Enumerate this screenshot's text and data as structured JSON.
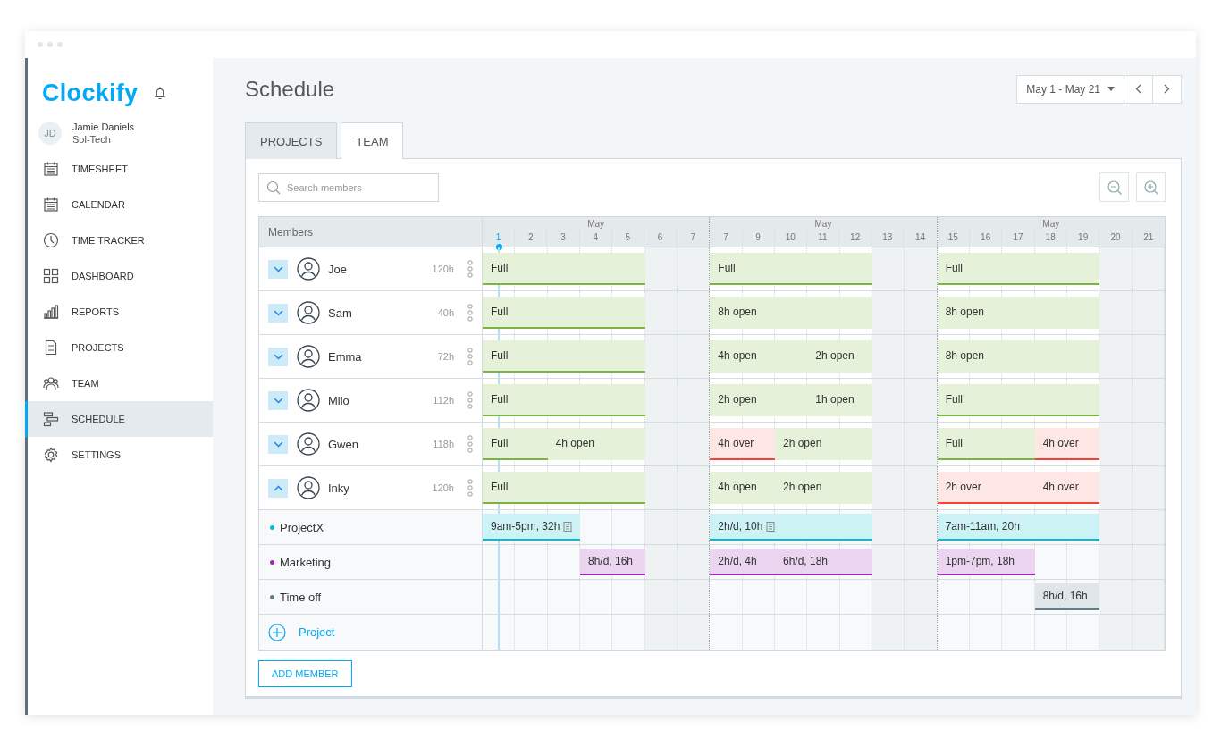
{
  "brand": "Clockify",
  "user": {
    "initials": "JD",
    "name": "Jamie Daniels",
    "workspace": "Sol-Tech"
  },
  "nav": [
    {
      "label": "TIMESHEET",
      "selected": false
    },
    {
      "label": "CALENDAR",
      "selected": false
    },
    {
      "label": "TIME TRACKER",
      "selected": false
    },
    {
      "label": "DASHBOARD",
      "selected": false
    },
    {
      "label": "REPORTS",
      "selected": false
    },
    {
      "label": "PROJECTS",
      "selected": false
    },
    {
      "label": "TEAM",
      "selected": false
    },
    {
      "label": "SCHEDULE",
      "selected": true
    },
    {
      "label": "SETTINGS",
      "selected": false
    }
  ],
  "page_title": "Schedule",
  "date_range": "May 1 - May 21",
  "tabs": [
    {
      "label": "PROJECTS",
      "selected": false
    },
    {
      "label": "TEAM",
      "selected": true
    }
  ],
  "search": {
    "placeholder": "Search members"
  },
  "members_header": "Members",
  "weeks": [
    {
      "month": "May",
      "days": [
        {
          "label": "1",
          "selected": true,
          "weekend": false
        },
        {
          "label": "2",
          "selected": false,
          "weekend": false
        },
        {
          "label": "3",
          "selected": false,
          "weekend": false
        },
        {
          "label": "4",
          "selected": false,
          "weekend": false
        },
        {
          "label": "5",
          "selected": false,
          "weekend": false
        },
        {
          "label": "6",
          "selected": false,
          "weekend": true
        },
        {
          "label": "7",
          "selected": false,
          "weekend": true
        }
      ]
    },
    {
      "month": "May",
      "days": [
        {
          "label": "7",
          "selected": false,
          "weekend": false
        },
        {
          "label": "9",
          "selected": false,
          "weekend": false
        },
        {
          "label": "10",
          "selected": false,
          "weekend": false
        },
        {
          "label": "11",
          "selected": false,
          "weekend": false
        },
        {
          "label": "12",
          "selected": false,
          "weekend": false
        },
        {
          "label": "13",
          "selected": false,
          "weekend": true
        },
        {
          "label": "14",
          "selected": false,
          "weekend": true
        }
      ]
    },
    {
      "month": "May",
      "days": [
        {
          "label": "15",
          "selected": false,
          "weekend": false
        },
        {
          "label": "16",
          "selected": false,
          "weekend": false
        },
        {
          "label": "17",
          "selected": false,
          "weekend": false
        },
        {
          "label": "18",
          "selected": false,
          "weekend": false
        },
        {
          "label": "19",
          "selected": false,
          "weekend": false
        },
        {
          "label": "20",
          "selected": false,
          "weekend": true
        },
        {
          "label": "21",
          "selected": false,
          "weekend": true
        }
      ]
    }
  ],
  "members": [
    {
      "name": "Joe",
      "hours": "120h",
      "expanded": false,
      "bars": [
        {
          "label": "Full",
          "kind": "full"
        },
        {
          "label": "Full",
          "kind": "full"
        },
        {
          "label": "Full",
          "kind": "full"
        }
      ]
    },
    {
      "name": "Sam",
      "hours": "40h",
      "expanded": false,
      "bars": [
        {
          "label": "Full",
          "kind": "full"
        },
        {
          "label": "8h open",
          "kind": "open"
        },
        {
          "label": "8h open",
          "kind": "open"
        }
      ]
    },
    {
      "name": "Emma",
      "hours": "72h",
      "expanded": false,
      "bars": [
        {
          "label": "Full",
          "kind": "full"
        },
        {
          "label": "4h open",
          "kind": "open"
        },
        {
          "label": "2h open",
          "kind": "open"
        },
        {
          "label": "8h open",
          "kind": "open"
        }
      ]
    },
    {
      "name": "Milo",
      "hours": "112h",
      "expanded": false,
      "bars": [
        {
          "label": "Full",
          "kind": "full"
        },
        {
          "label": "2h open",
          "kind": "open"
        },
        {
          "label": "1h open",
          "kind": "open"
        },
        {
          "label": "Full",
          "kind": "full"
        }
      ]
    },
    {
      "name": "Gwen",
      "hours": "118h",
      "expanded": false,
      "bars": [
        {
          "label": "Full",
          "kind": "full"
        },
        {
          "label": "4h open",
          "kind": "open"
        },
        {
          "label": "4h over",
          "kind": "over"
        },
        {
          "label": "2h open",
          "kind": "open"
        },
        {
          "label": "Full",
          "kind": "full"
        },
        {
          "label": "4h over",
          "kind": "over"
        }
      ]
    },
    {
      "name": "Inky",
      "hours": "120h",
      "expanded": true,
      "bars": [
        {
          "label": "Full",
          "kind": "full"
        },
        {
          "label": "4h open",
          "kind": "open"
        },
        {
          "label": "2h open",
          "kind": "open"
        },
        {
          "label": "2h over",
          "kind": "over"
        },
        {
          "label": "4h over",
          "kind": "over"
        }
      ]
    }
  ],
  "projects": [
    {
      "name": "ProjectX",
      "color": "#00bcd4",
      "bars": [
        {
          "label": "9am-5pm, 32h",
          "note": true
        },
        {
          "label": "2h/d, 10h",
          "note": true
        },
        {
          "label": "7am-11am, 20h",
          "note": false
        }
      ]
    },
    {
      "name": "Marketing",
      "color": "#9c27b0",
      "bars": [
        {
          "label": "8h/d, 16h",
          "note": false
        },
        {
          "label": "2h/d, 4h",
          "note": false
        },
        {
          "label": "6h/d, 18h",
          "note": false
        },
        {
          "label": "1pm-7pm, 18h",
          "note": false
        }
      ]
    },
    {
      "name": "Time off",
      "color": "#607d8b",
      "bars": [
        {
          "label": "8h/d, 16h",
          "note": false
        }
      ]
    }
  ],
  "add_project": "Project",
  "add_member": "ADD MEMBER"
}
